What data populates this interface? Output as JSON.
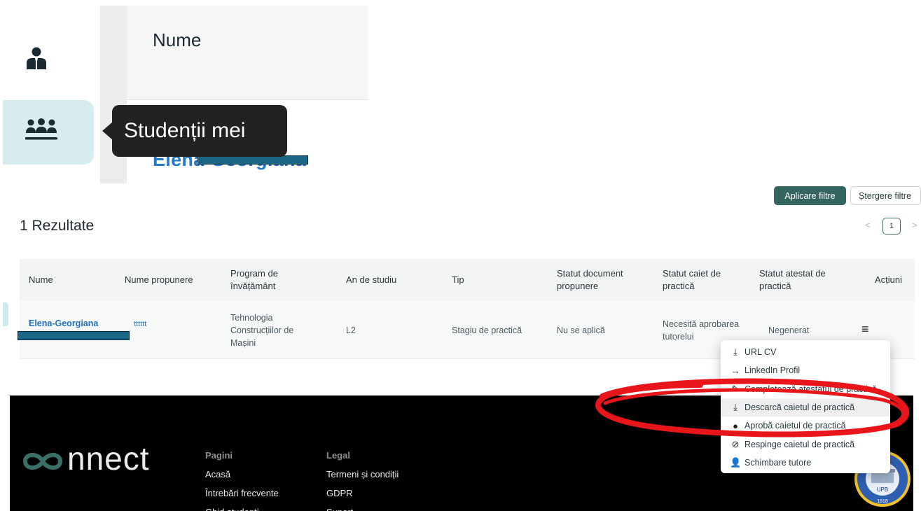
{
  "top": {
    "column_header": "Nume",
    "tooltip": "Studenții mei",
    "student_name_large": "Elena-Georgiana"
  },
  "filters": {
    "apply_label": "Aplicare filtre",
    "clear_label": "Ștergere filtre"
  },
  "results": {
    "count_label": "1 Rezultate",
    "page_prev": "<",
    "page_current": "1",
    "page_next": ">"
  },
  "table": {
    "headers": [
      "Nume",
      "Nume propunere",
      "Program de învățământ",
      "An de studiu",
      "Tip",
      "Statut document propunere",
      "Statut caiet de practică",
      "Statut atestat de practică",
      "Acțiuni"
    ],
    "row": {
      "name": "Elena-Georgiana",
      "proposal": "tttttt",
      "program": "Tehnologia Construcțiilor de Mașini",
      "year": "L2",
      "type": "Stagiu de practică",
      "proposal_status": "Nu se aplică",
      "notebook_status": "Necesită aprobarea tutorelui",
      "certificate_status": "Negenerat",
      "actions_icon": "≡"
    }
  },
  "menu": {
    "items": [
      {
        "icon": "download-icon",
        "label": "URL CV"
      },
      {
        "icon": "arrow-right-icon",
        "label": "LinkedIn Profil"
      },
      {
        "icon": "pencil-icon",
        "label": "Completează atestatul de practică"
      },
      {
        "icon": "download-icon",
        "label": "Descarcă caietul de practică"
      },
      {
        "icon": "check-circle-icon",
        "label": "Aprobă caietul de practică"
      },
      {
        "icon": "block-icon",
        "label": "Respinge caietul de practică"
      },
      {
        "icon": "user-edit-icon",
        "label": "Schimbare tutore"
      }
    ]
  },
  "footer": {
    "logo": "nnect",
    "pages_heading": "Pagini",
    "pages": [
      "Acasă",
      "Întrebări frecvente",
      "Ghid studenți"
    ],
    "legal_heading": "Legal",
    "legal": [
      "Termeni și condiții",
      "GDPR",
      "Suport"
    ],
    "seal_year": "1818",
    "seal_text": "UPB"
  },
  "colors": {
    "accent": "#35655f",
    "link": "#1f6fc0",
    "annotation": "#e8151b"
  }
}
